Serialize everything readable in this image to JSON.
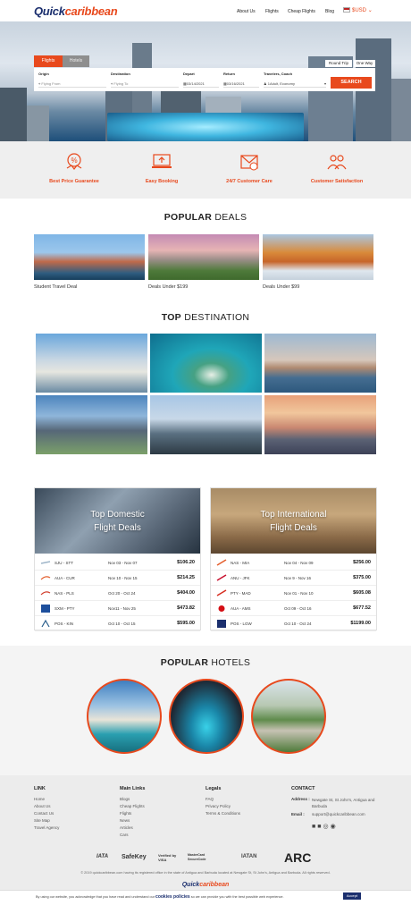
{
  "brand": {
    "logo_part1": "Quick",
    "logo_part2": "caribbean"
  },
  "nav": {
    "items": [
      "About Us",
      "Flights",
      "Cheap Flights",
      "Blog"
    ],
    "currency": "$USD"
  },
  "search": {
    "tabs": [
      "Flights",
      "Hotels"
    ],
    "trip_types": [
      "Round Trip",
      "One Way"
    ],
    "origin_label": "Origin",
    "origin_placeholder": "Flying From",
    "destination_label": "Destination",
    "destination_placeholder": "Flying To",
    "depart_label": "Depart",
    "depart_value": "03/14/2021",
    "return_label": "Return",
    "return_value": "03/16/2021",
    "travelers_label": "Travelers, Coach",
    "travelers_value": "1Adult, Economy",
    "button": "SEARCH"
  },
  "features": [
    "Best Price Guarantee",
    "Easy Booking",
    "24/7 Customer Care",
    "Customer Satisfaction"
  ],
  "popular_deals": {
    "title_bold": "POPULAR",
    "title_rest": " DEALS",
    "items": [
      "Student Travel Deal",
      "Deals Under $199",
      "Deals Under $99"
    ]
  },
  "top_destination": {
    "title_bold": "TOP",
    "title_rest": " DESTINATION"
  },
  "domestic": {
    "title_line1": "Top Domestic",
    "title_line2": "Flight Deals",
    "rows": [
      {
        "route": "SJU - STT",
        "dates": "Nov 03 - Nov 07",
        "price": "$106.20"
      },
      {
        "route": "AUA - CUR",
        "dates": "Nov 10 - Nov 15",
        "price": "$214.25"
      },
      {
        "route": "NAS - PLS",
        "dates": "Oct 20 - Oct 24",
        "price": "$404.00"
      },
      {
        "route": "SXM - PTY",
        "dates": "Nov11 - Nov 25",
        "price": "$473.82"
      },
      {
        "route": "POS - KIN",
        "dates": "Oct 10 - Oct 15",
        "price": "$595.00"
      }
    ]
  },
  "international": {
    "title_line1": "Top International",
    "title_line2": "Flight Deals",
    "rows": [
      {
        "route": "NAS - MIA",
        "dates": "Nov 04 - Nov 09",
        "price": "$256.00"
      },
      {
        "route": "ANU - JFK",
        "dates": "Nov 9 - Nov 16",
        "price": "$375.00"
      },
      {
        "route": "PTY - MAD",
        "dates": "Nov 01 - Nov 10",
        "price": "$605.08"
      },
      {
        "route": "AUA - AMS",
        "dates": "Oct 09 - Oct 16",
        "price": "$677.52"
      },
      {
        "route": "POS - LGW",
        "dates": "Oct 10 - Oct 24",
        "price": "$1199.00"
      }
    ]
  },
  "hotels": {
    "title_bold": "POPULAR",
    "title_rest": " HOTELS"
  },
  "footer": {
    "link_title": "LINK",
    "links": [
      "Home",
      "About Us",
      "Contact Us",
      "Site Map",
      "Travel Agency"
    ],
    "main_title": "Main Links",
    "main_links": [
      "Blogs",
      "Cheap Flights",
      "Flights",
      "News",
      "Articles",
      "Cars"
    ],
    "legals_title": "Legals",
    "legals": [
      "FAQ",
      "Privacy Policy",
      "Terms & Conditions"
    ],
    "contact_title": "CONTACT",
    "address_label": "Address :",
    "address": "Newgate St, St John's, Antigua and Barbuda",
    "email_label": "Email :",
    "email": "support@quickcaribbean.com",
    "badges": [
      "IATA",
      "SafeKey",
      "Verified by VISA",
      "MasterCard SecureCode",
      "IATAN",
      "ARC"
    ],
    "copyright": "© 2019 quickcaribbean.com having its registered office in the state of Antigua and Barbuda located at Newgate St, St John's, Antigua and Barbuda. All rights reserved.",
    "logo_part1": "Quick",
    "logo_part2": "caribbean",
    "cookie_text_1": "By using our website, you acknowledge that you have read and understand our",
    "cookie_link": "cookies policies",
    "cookie_text_2": "so we can provide you with the best possible web experience.",
    "cookie_button": "Accept"
  },
  "colors": {
    "accent": "#e8491d",
    "brand_navy": "#1b2f6e",
    "feature_bg": "#efefef"
  }
}
